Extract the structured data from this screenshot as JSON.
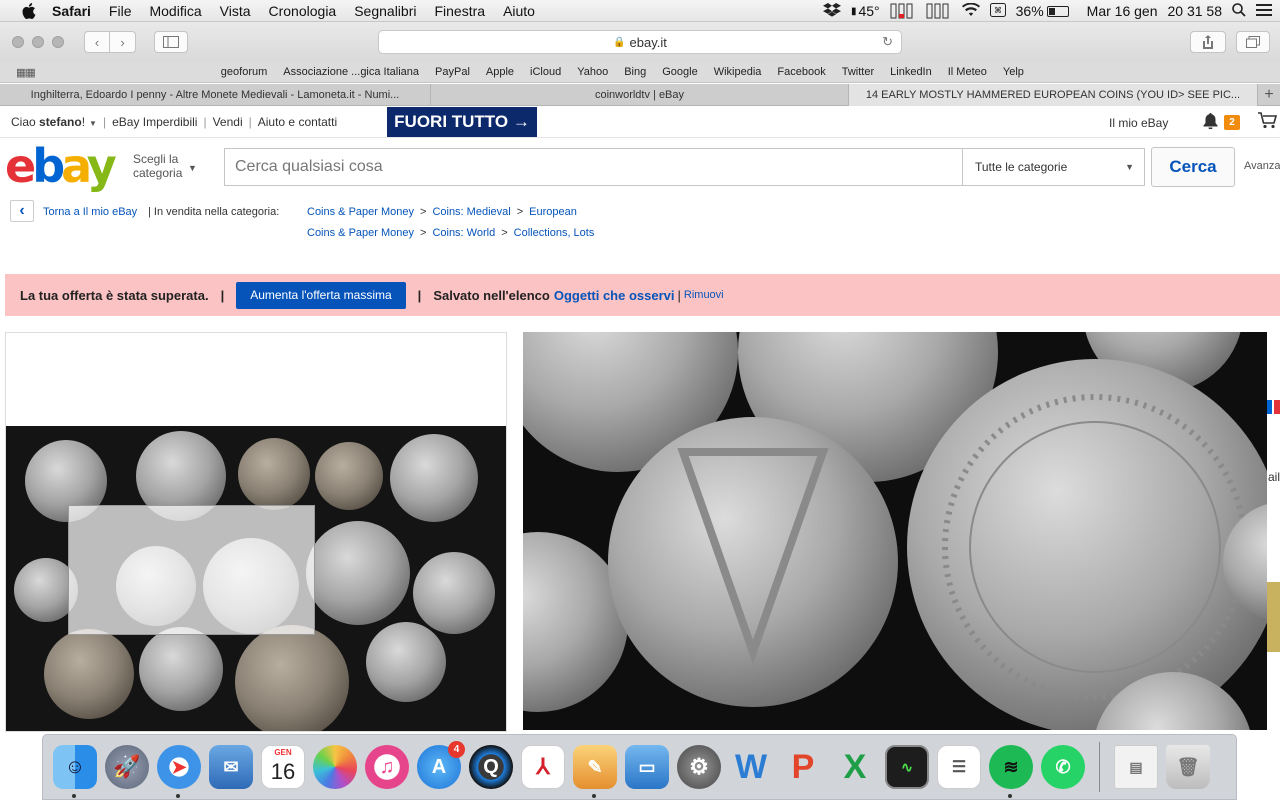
{
  "menubar": {
    "app_name": "Safari",
    "menus": [
      "File",
      "Modifica",
      "Vista",
      "Cronologia",
      "Segnalibri",
      "Finestra",
      "Aiuto"
    ],
    "temperature": "45°",
    "battery_percent_label": "36%",
    "battery_level": 0.36,
    "date": "Mar 16 gen",
    "time": "20 31 58"
  },
  "browser": {
    "url": "ebay.it",
    "bookmarks": [
      "geoforum",
      "Associazione ...gica Italiana",
      "PayPal",
      "Apple",
      "iCloud",
      "Yahoo",
      "Bing",
      "Google",
      "Wikipedia",
      "Facebook",
      "Twitter",
      "LinkedIn",
      "Il Meteo",
      "Yelp"
    ],
    "tabs": [
      {
        "title": "Inghilterra, Edoardo I penny - Altre Monete Medievali - Lamoneta.it - Numi...",
        "active": false
      },
      {
        "title": "coinworldtv | eBay",
        "active": false
      },
      {
        "title": "14 EARLY MOSTLY HAMMERED EUROPEAN COINS (YOU ID> SEE PIC...",
        "active": true
      }
    ],
    "new_tab_label": "+"
  },
  "ebay": {
    "topnav": {
      "greeting_prefix": "Ciao ",
      "user_name": "stefano",
      "greeting_suffix": "!",
      "links": [
        "eBay Imperdibili",
        "Vendi",
        "Aiuto e contatti"
      ],
      "banner": "FUORI TUTTO →",
      "my_ebay": "Il mio eBay",
      "notification_count": "2"
    },
    "header": {
      "shop_by_category": "Scegli la categoria",
      "search_placeholder": "Cerca qualsiasi cosa",
      "category_selected": "Tutte le categorie",
      "search_button": "Cerca",
      "advanced": "Avanza"
    },
    "breadcrumbs": {
      "back_label": "Torna a Il mio eBay",
      "in_sale_label": "| In vendita nella categoria:",
      "paths": [
        [
          "Coins & Paper Money",
          "Coins: Medieval",
          "European"
        ],
        [
          "Coins & Paper Money",
          "Coins: World",
          "Collections, Lots"
        ]
      ]
    },
    "alert": {
      "outbid_message": "La tua offerta è stata superata.",
      "raise_bid_button": "Aumenta l'offerta massima",
      "saved_label": "Salvato nell'elenco",
      "watchlist_link": "Oggetti che osservi",
      "remove_link": "Rimuovi"
    },
    "right_edge_text": "ail"
  },
  "dock": {
    "calendar_month": "GEN",
    "calendar_day": "16",
    "app_store_badge": "4"
  }
}
